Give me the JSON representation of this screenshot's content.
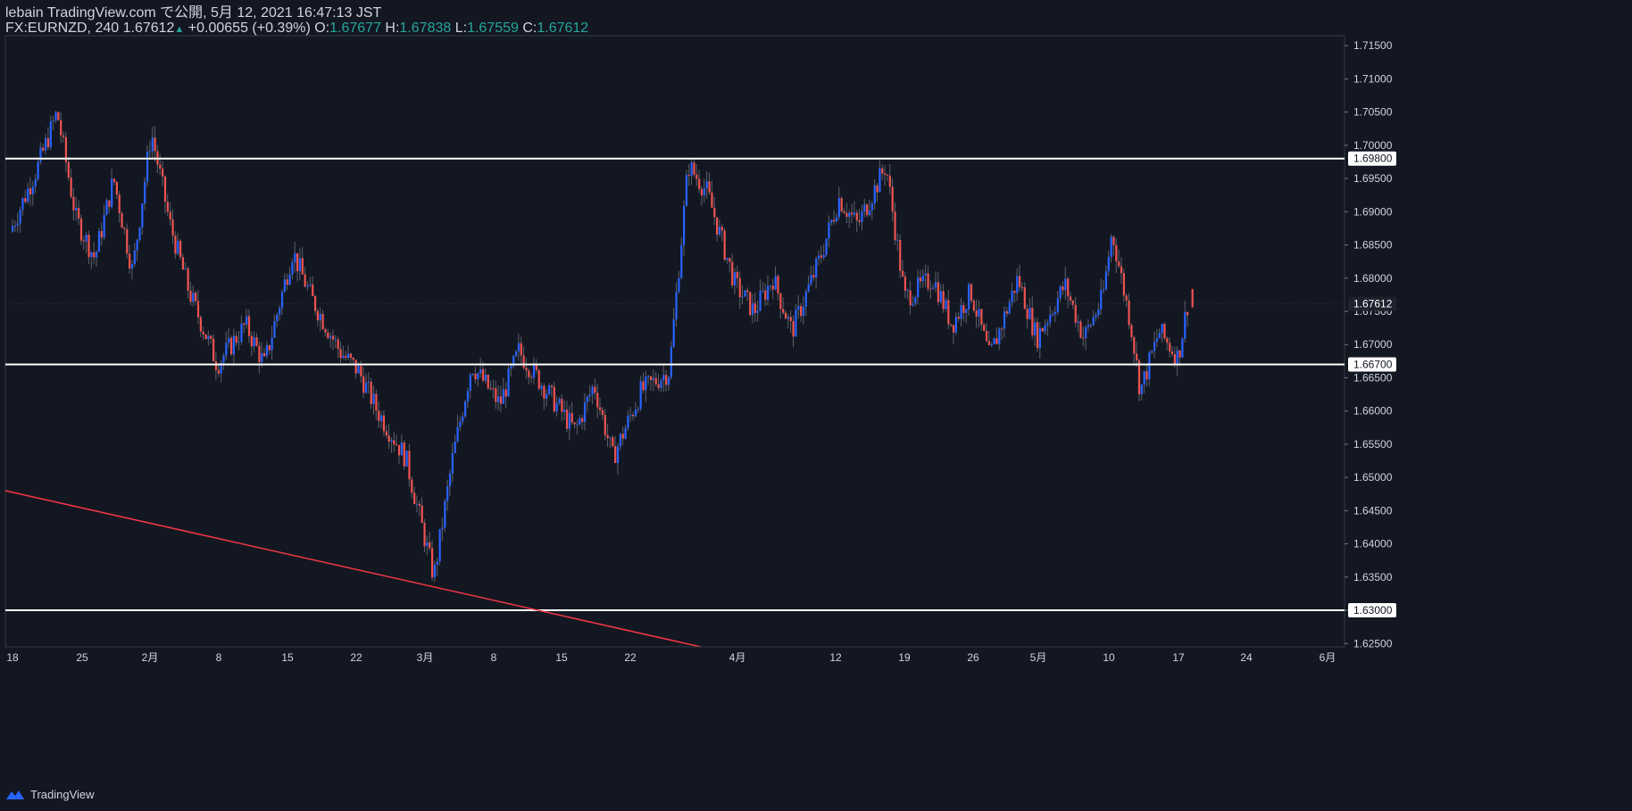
{
  "header": {
    "line1": "lebain TradingView.com で公開, 5月 12, 2021 16:47:13 JST",
    "symbol": "FX:EURNZD, 240",
    "last": "1.67612",
    "change": "+0.00655 (+0.39%)",
    "o_label": "O:",
    "o": "1.67677",
    "h_label": "H:",
    "h": "1.67838",
    "l_label": "L:",
    "l": "1.67559",
    "c_label": "C:",
    "c": "1.67612"
  },
  "footer": {
    "brand": "TradingView"
  },
  "colors": {
    "bg": "#131722",
    "up": "#2962ff",
    "down": "#ef5350",
    "level": "#ffffff",
    "trend": "#f23645",
    "axis_text": "#d1d4dc"
  },
  "chart_data": {
    "type": "candlestick",
    "ylim": [
      1.6245,
      1.7165
    ],
    "y_ticks": [
      "1.71500",
      "1.71000",
      "1.70500",
      "1.70000",
      "1.69500",
      "1.69000",
      "1.68500",
      "1.68000",
      "1.67500",
      "1.67000",
      "1.66500",
      "1.66000",
      "1.65500",
      "1.65000",
      "1.64500",
      "1.64000",
      "1.63500",
      "1.63000",
      "1.62500"
    ],
    "x_ticks": [
      "18",
      "25",
      "2月",
      "8",
      "15",
      "22",
      "3月",
      "8",
      "15",
      "22",
      "4月",
      "12",
      "19",
      "26",
      "5月",
      "10",
      "17",
      "24",
      "6月"
    ],
    "horizontal_levels": [
      {
        "value": 1.698,
        "label": "1.69800"
      },
      {
        "value": 1.667,
        "label": "1.66700"
      },
      {
        "value": 1.63,
        "label": "1.63000"
      }
    ],
    "trendline": {
      "from": {
        "x": "Jan 14",
        "y": 1.648
      },
      "to": {
        "x": "Mar 31",
        "y": 1.6245
      }
    },
    "current_price": {
      "value": 1.67612,
      "label": "1.67612"
    },
    "path": [
      [
        0,
        1.687
      ],
      [
        3,
        1.697
      ],
      [
        5,
        1.705
      ],
      [
        7,
        1.689
      ],
      [
        9,
        1.683
      ],
      [
        11,
        1.695
      ],
      [
        13,
        1.681
      ],
      [
        15,
        1.702
      ],
      [
        17,
        1.688
      ],
      [
        19,
        1.678
      ],
      [
        22,
        1.667
      ],
      [
        25,
        1.673
      ],
      [
        27,
        1.667
      ],
      [
        30,
        1.684
      ],
      [
        32,
        1.677
      ],
      [
        35,
        1.669
      ],
      [
        37,
        1.666
      ],
      [
        39,
        1.66
      ],
      [
        42,
        1.653
      ],
      [
        44,
        1.641
      ],
      [
        45,
        1.635
      ],
      [
        47,
        1.653
      ],
      [
        49,
        1.667
      ],
      [
        52,
        1.661
      ],
      [
        54,
        1.669
      ],
      [
        57,
        1.663
      ],
      [
        60,
        1.657
      ],
      [
        62,
        1.664
      ],
      [
        64,
        1.653
      ],
      [
        67,
        1.663
      ],
      [
        70,
        1.666
      ],
      [
        72,
        1.697
      ],
      [
        74,
        1.693
      ],
      [
        77,
        1.679
      ],
      [
        79,
        1.675
      ],
      [
        81,
        1.68
      ],
      [
        83,
        1.672
      ],
      [
        86,
        1.683
      ],
      [
        88,
        1.692
      ],
      [
        90,
        1.688
      ],
      [
        93,
        1.697
      ],
      [
        95,
        1.677
      ],
      [
        98,
        1.68
      ],
      [
        100,
        1.673
      ],
      [
        102,
        1.678
      ],
      [
        104,
        1.668
      ],
      [
        107,
        1.68
      ],
      [
        109,
        1.671
      ],
      [
        112,
        1.679
      ],
      [
        114,
        1.671
      ],
      [
        116,
        1.677
      ],
      [
        117,
        1.687
      ],
      [
        119,
        1.673
      ],
      [
        120,
        1.663
      ],
      [
        122,
        1.672
      ],
      [
        124,
        1.668
      ],
      [
        125,
        1.676
      ]
    ]
  }
}
